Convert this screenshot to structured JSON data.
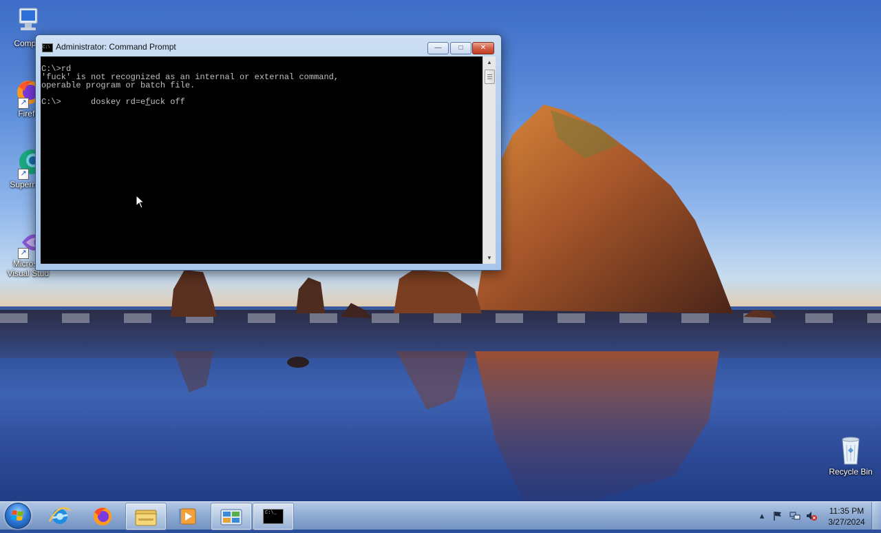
{
  "desktop": {
    "icons": [
      {
        "label": "Compu",
        "icon": "computer-icon"
      },
      {
        "label": "Firefo",
        "icon": "firefox-icon"
      },
      {
        "label": "Supermi",
        "icon": "app-icon"
      },
      {
        "label": "Microso\nVisual Stud",
        "line1": "Microso",
        "line2": "Visual Stud",
        "icon": "visual-studio-icon"
      }
    ],
    "recycle_bin_label": "Recycle Bin"
  },
  "cmd_window": {
    "title": "Administrator: Command Prompt",
    "title_icon_text": "C:\\",
    "lines": [
      "C:\\>rd",
      "'fuck' is not recognized as an internal or external command,",
      "operable program or batch file.",
      "",
      "C:\\>      doskey rd=e"
    ],
    "caret_char": "f",
    "after_caret": "uck off",
    "buttons": {
      "minimize": "—",
      "maximize": "□",
      "close": "✕"
    }
  },
  "taskbar": {
    "pinned": [
      "start-orb",
      "internet-explorer-icon",
      "firefox-icon",
      "file-explorer-icon",
      "media-player-icon",
      "control-panel-icon",
      "command-prompt-icon"
    ],
    "cmd_icon_text": "C:\\_",
    "clock_time": "11:35 PM",
    "clock_date": "3/27/2024",
    "tray_icons": [
      "show-hidden-icons",
      "action-center-flag-icon",
      "network-icon",
      "volume-muted-icon"
    ]
  },
  "colors": {
    "console_bg": "#000000",
    "console_text": "#c0c0c0",
    "titlebar": "#b9d1ee",
    "taskbar": "#96b2d7"
  }
}
